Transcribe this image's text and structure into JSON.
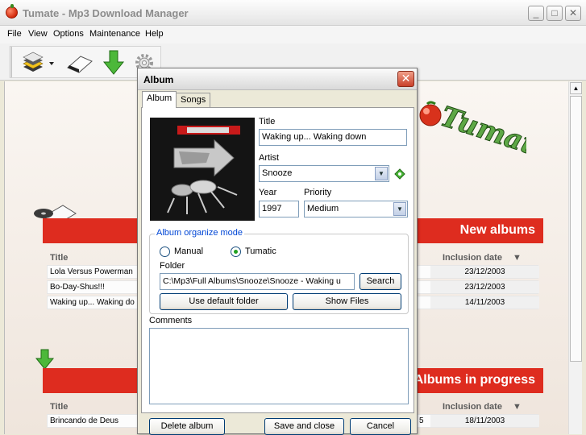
{
  "window": {
    "title": "Tumate - Mp3 Download Manager",
    "minimize": "_",
    "maximize": "□",
    "close": "✕"
  },
  "menu": [
    "File",
    "View",
    "Options",
    "Maintenance",
    "Help"
  ],
  "toolbar": {
    "icons": [
      "albums-stack-icon",
      "eraser-icon",
      "download-arrow-icon",
      "gear-icon"
    ]
  },
  "logo": {
    "text": "Tumate"
  },
  "new_albums": {
    "title": "New albums",
    "col_title": "Title",
    "col_date": "Inclusion date",
    "rows": [
      {
        "title": "Lola Versus Powerman",
        "date": "23/12/2003"
      },
      {
        "title": "Bo-Day-Shus!!!",
        "date": "23/12/2003"
      },
      {
        "title": "Waking up... Waking do",
        "date": "14/11/2003"
      }
    ]
  },
  "albums_in_progress": {
    "title": "Albums in progress",
    "col_title": "Title",
    "col_date": "Inclusion date",
    "rows": [
      {
        "title": "Brincando de Deus",
        "extra": "5",
        "date": "18/11/2003"
      }
    ]
  },
  "dialog": {
    "title": "Album",
    "tabs": [
      "Album",
      "Songs"
    ],
    "title_label": "Title",
    "title_value": "Waking up... Waking down",
    "artist_label": "Artist",
    "artist_value": "Snooze",
    "year_label": "Year",
    "year_value": "1997",
    "priority_label": "Priority",
    "priority_value": "Medium",
    "organize_label": "Album organize mode",
    "radio_manual": "Manual",
    "radio_tumatic": "Tumatic",
    "folder_label": "Folder",
    "folder_value": "C:\\Mp3\\Full Albums\\Snooze\\Snooze - Waking u",
    "search_btn": "Search",
    "default_folder_btn": "Use default folder",
    "show_files_btn": "Show Files",
    "comments_label": "Comments",
    "delete_btn": "Delete album",
    "save_btn": "Save and close",
    "cancel_btn": "Cancel"
  },
  "colors": {
    "accent_red": "#de2c1f",
    "xp_blue": "#0046d5"
  }
}
